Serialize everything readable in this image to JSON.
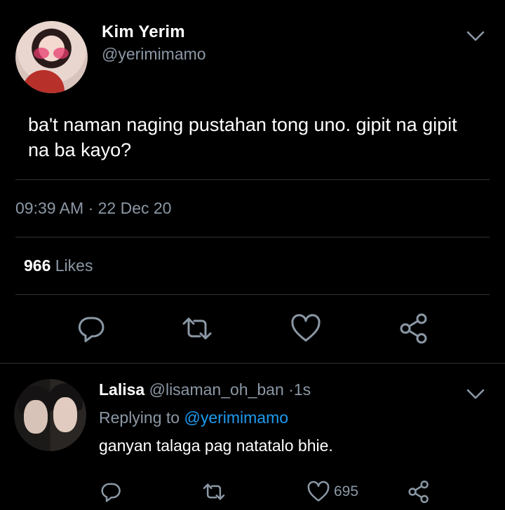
{
  "tweet": {
    "author_name": "Kim Yerim",
    "author_handle": "@yerimimamo",
    "text": "ba't naman naging pustahan tong uno. gipit na gipit na ba kayo?",
    "timestamp": "09:39 AM · 22 Dec 20",
    "likes_count": "966",
    "likes_label": "Likes",
    "actions": [
      "comment-icon",
      "retweet-icon",
      "heart-icon",
      "share-icon"
    ]
  },
  "reply": {
    "author_name": "Lalisa",
    "author_handle": "@lisaman_oh_ban",
    "separator": "·",
    "time_ago": "1s",
    "replying_prefix": "Replying to",
    "replying_to": "@yerimimamo",
    "text": "ganyan talaga pag natatalo bhie.",
    "like_count": "695",
    "actions": [
      "comment-icon",
      "retweet-icon",
      "heart-icon",
      "share-icon"
    ]
  },
  "colors": {
    "background": "#000000",
    "primary_text": "#ffffff",
    "secondary_text": "#8b98a5",
    "accent": "#1d9bf0",
    "divider": "#2f3336"
  }
}
